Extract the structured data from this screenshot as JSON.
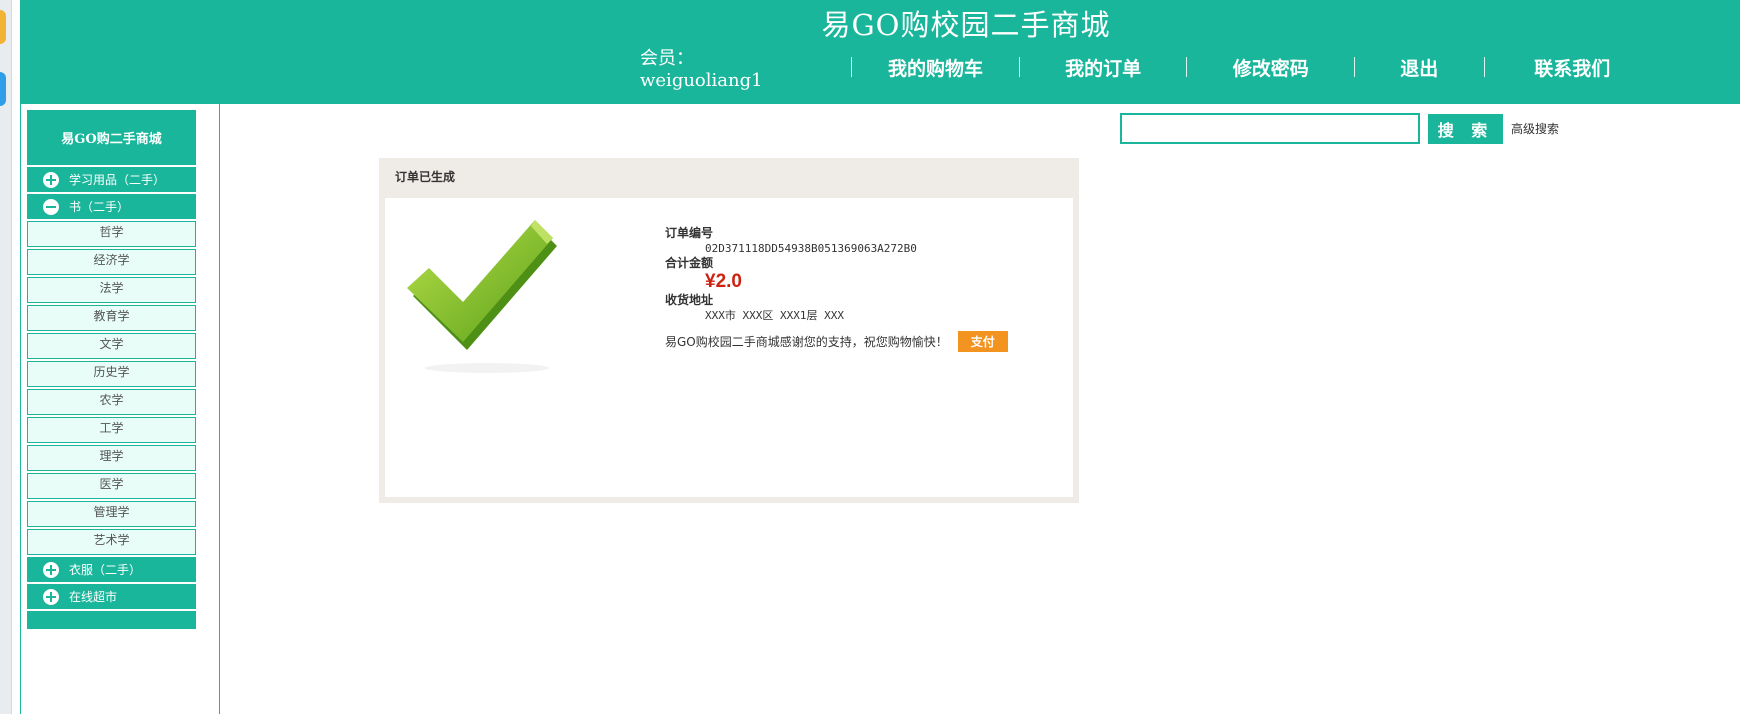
{
  "header": {
    "title": "易GO购校园二手商城",
    "member": "会员：weiguoliang1",
    "nav": [
      "我的购物车",
      "我的订单",
      "修改密码",
      "退出",
      "联系我们"
    ]
  },
  "sidebar": {
    "heading": "易GO购二手商城",
    "categories": [
      {
        "label": "学习用品（二手）",
        "icon": "plus-circle-icon"
      },
      {
        "label": "书（二手）",
        "icon": "minus-circle-icon"
      },
      {
        "label": "衣服（二手）",
        "icon": "plus-circle-icon"
      },
      {
        "label": "在线超市",
        "icon": "plus-circle-icon"
      }
    ],
    "subitems": [
      "哲学",
      "经济学",
      "法学",
      "教育学",
      "文学",
      "历史学",
      "农学",
      "工学",
      "理学",
      "医学",
      "管理学",
      "艺术学"
    ]
  },
  "search": {
    "value": "",
    "button_label": "搜 索",
    "advanced_label": "高级搜索"
  },
  "order": {
    "panel_title": "订单已生成",
    "number_label": "订单编号",
    "number": "02D371118DD54938B051369063A272B0",
    "total_label": "合计金额",
    "total": "¥2.0",
    "address_label": "收货地址",
    "address": "XXX市 XXX区 XXX1层 XXX",
    "thanks": "易GO购校园二手商城感谢您的支持，祝您购物愉快！",
    "pay_label": "支付"
  },
  "colors": {
    "brand": "#1ab69b",
    "panel_bg": "#efebe7",
    "price": "#cc2211",
    "pay_button": "#f39421",
    "sub_item_bg": "#e8fdf8"
  }
}
